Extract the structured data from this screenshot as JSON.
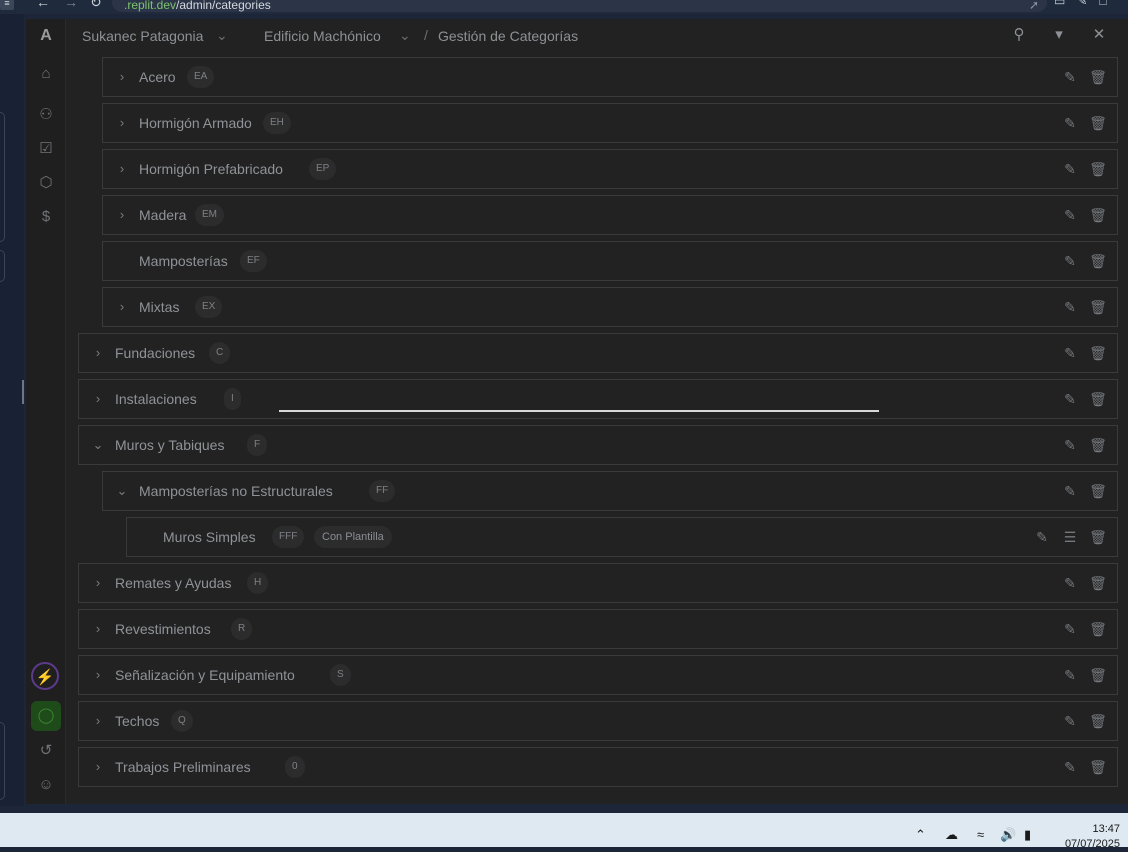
{
  "browser": {
    "tab_icon": "≡",
    "url_host": ".replit.dev",
    "url_path": "/admin/categories",
    "nav_icons": [
      "back-icon",
      "forward-icon",
      "reload-icon",
      "share-icon"
    ]
  },
  "app": {
    "logo": "A",
    "breadcrumb": {
      "item1": "Sukanec Patagonia",
      "item2": "Edificio Machónico",
      "current": "Gestión de Categorías"
    },
    "rail_icons": [
      "home-icon",
      "users-icon",
      "checklist-icon",
      "box-icon",
      "dollar-icon",
      "bolt-icon",
      "shield-icon",
      "history-icon",
      "account-icon"
    ],
    "categories": [
      {
        "name": "Acero",
        "code": "EA",
        "level": 1,
        "expandable": true,
        "expanded": false
      },
      {
        "name": "Hormigón Armado",
        "code": "EH",
        "level": 1,
        "expandable": true,
        "expanded": false
      },
      {
        "name": "Hormigón Prefabricado",
        "code": "EP",
        "level": 1,
        "expandable": true,
        "expanded": false
      },
      {
        "name": "Madera",
        "code": "EM",
        "level": 1,
        "expandable": true,
        "expanded": false
      },
      {
        "name": "Mamposterías",
        "code": "EF",
        "level": 1,
        "expandable": false,
        "expanded": false
      },
      {
        "name": "Mixtas",
        "code": "EX",
        "level": 1,
        "expandable": true,
        "expanded": false
      },
      {
        "name": "Fundaciones",
        "code": "C",
        "level": 0,
        "expandable": true,
        "expanded": false
      },
      {
        "name": "Instalaciones",
        "code": "I",
        "level": 0,
        "expandable": true,
        "expanded": false
      },
      {
        "name": "Muros y Tabiques",
        "code": "F",
        "level": 0,
        "expandable": true,
        "expanded": true
      },
      {
        "name": "Mamposterías no Estructurales",
        "code": "FF",
        "level": 1,
        "expandable": true,
        "expanded": true
      },
      {
        "name": "Muros Simples",
        "code": "FFF",
        "level": 2,
        "expandable": false,
        "expanded": false,
        "template": "Con Plantilla"
      },
      {
        "name": "Remates y Ayudas",
        "code": "H",
        "level": 0,
        "expandable": true,
        "expanded": false
      },
      {
        "name": "Revestimientos",
        "code": "R",
        "level": 0,
        "expandable": true,
        "expanded": false
      },
      {
        "name": "Señalización y Equipamiento",
        "code": "S",
        "level": 0,
        "expandable": true,
        "expanded": false
      },
      {
        "name": "Techos",
        "code": "Q",
        "level": 0,
        "expandable": true,
        "expanded": false
      },
      {
        "name": "Trabajos Preliminares",
        "code": "0",
        "level": 0,
        "expandable": true,
        "expanded": false
      }
    ]
  },
  "taskbar": {
    "time": "13:47",
    "date": "07/07/2025"
  }
}
